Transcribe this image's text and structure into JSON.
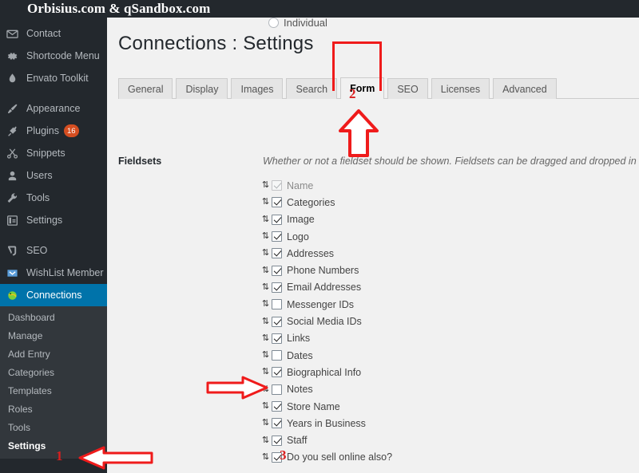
{
  "adminbar": {
    "site_title": "Orbisius.com & qSandbox.com"
  },
  "sidebar": {
    "items": [
      {
        "label": "Contact",
        "icon": "envelope-icon"
      },
      {
        "label": "Shortcode Menu",
        "icon": "gear-icon"
      },
      {
        "label": "Envato Toolkit",
        "icon": "droplet-icon"
      },
      {
        "label": "Appearance",
        "icon": "paintbrush-icon"
      },
      {
        "label": "Plugins",
        "icon": "plug-icon",
        "badge": "16"
      },
      {
        "label": "Snippets",
        "icon": "scissors-icon"
      },
      {
        "label": "Users",
        "icon": "user-icon"
      },
      {
        "label": "Tools",
        "icon": "wrench-icon"
      },
      {
        "label": "Settings",
        "icon": "sliders-icon"
      },
      {
        "label": "SEO",
        "icon": "yoast-icon"
      },
      {
        "label": "WishList Member",
        "icon": "chevron-box-icon"
      },
      {
        "label": "Connections",
        "icon": "connections-icon",
        "active": true
      }
    ],
    "submenu": [
      {
        "label": "Dashboard"
      },
      {
        "label": "Manage"
      },
      {
        "label": "Add Entry"
      },
      {
        "label": "Categories"
      },
      {
        "label": "Templates"
      },
      {
        "label": "Roles"
      },
      {
        "label": "Tools"
      },
      {
        "label": "Settings",
        "current": true
      }
    ]
  },
  "content": {
    "clipped_radio_label": "Individual",
    "page_title": "Connections : Settings",
    "tabs": [
      {
        "label": "General"
      },
      {
        "label": "Display"
      },
      {
        "label": "Images"
      },
      {
        "label": "Search"
      },
      {
        "label": "Form",
        "active": true
      },
      {
        "label": "SEO"
      },
      {
        "label": "Licenses"
      },
      {
        "label": "Advanced"
      }
    ],
    "fieldsets_row": {
      "label": "Fieldsets",
      "description": "Whether or not a fieldset should be shown. Fieldsets can be dragged and dropped in the"
    },
    "fieldsets": [
      {
        "label": "Name",
        "checked": true,
        "disabled": true
      },
      {
        "label": "Categories",
        "checked": true,
        "disabled": false
      },
      {
        "label": "Image",
        "checked": true,
        "disabled": false
      },
      {
        "label": "Logo",
        "checked": true,
        "disabled": false
      },
      {
        "label": "Addresses",
        "checked": true,
        "disabled": false
      },
      {
        "label": "Phone Numbers",
        "checked": true,
        "disabled": false
      },
      {
        "label": "Email Addresses",
        "checked": true,
        "disabled": false
      },
      {
        "label": "Messenger IDs",
        "checked": false,
        "disabled": false
      },
      {
        "label": "Social Media IDs",
        "checked": true,
        "disabled": false
      },
      {
        "label": "Links",
        "checked": true,
        "disabled": false
      },
      {
        "label": "Dates",
        "checked": false,
        "disabled": false
      },
      {
        "label": "Biographical Info",
        "checked": true,
        "disabled": false
      },
      {
        "label": "Notes",
        "checked": false,
        "disabled": false
      },
      {
        "label": "Store Name",
        "checked": true,
        "disabled": false
      },
      {
        "label": "Years in Business",
        "checked": true,
        "disabled": false
      },
      {
        "label": "Staff",
        "checked": true,
        "disabled": false
      },
      {
        "label": "Do you sell online also?",
        "checked": true,
        "disabled": false
      }
    ]
  },
  "annotations": {
    "color": "#ef1b1b",
    "marker_1": "1",
    "marker_2": "2",
    "marker_3": "3"
  }
}
